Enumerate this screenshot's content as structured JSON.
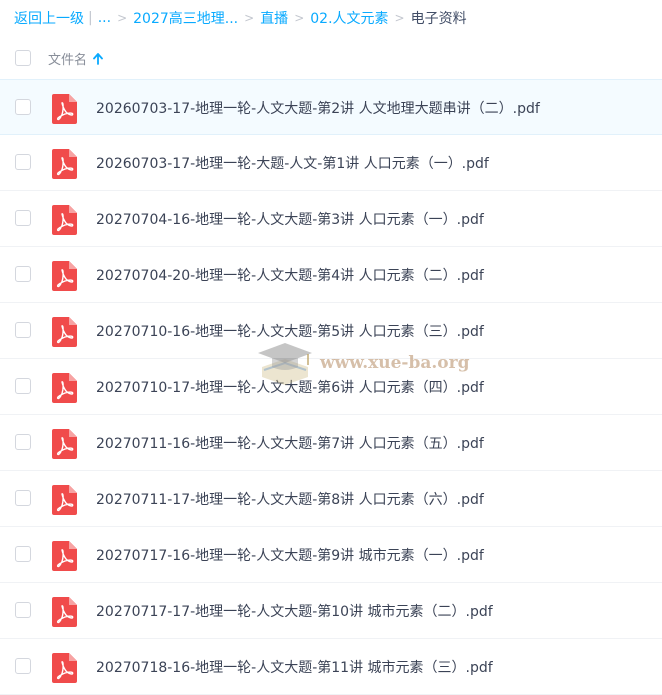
{
  "breadcrumb": {
    "back": "返回上一级",
    "ellipsis": "...",
    "crumbs": [
      "2027高三地理...",
      "直播",
      "02.人文元素"
    ],
    "current": "电子资料"
  },
  "header": {
    "column_label": "文件名"
  },
  "files": [
    "20260703-17-地理一轮-人文大题-第2讲 人文地理大题串讲（二）.pdf",
    "20260703-17-地理一轮-大题-人文-第1讲 人口元素（一）.pdf",
    "20270704-16-地理一轮-人文大题-第3讲 人口元素（一）.pdf",
    "20270704-20-地理一轮-人文大题-第4讲 人口元素（二）.pdf",
    "20270710-16-地理一轮-人文大题-第5讲 人口元素（三）.pdf",
    "20270710-17-地理一轮-人文大题-第6讲 人口元素（四）.pdf",
    "20270711-16-地理一轮-人文大题-第7讲 人口元素（五）.pdf",
    "20270711-17-地理一轮-人文大题-第8讲 人口元素（六）.pdf",
    "20270717-16-地理一轮-人文大题-第9讲 城市元素（一）.pdf",
    "20270717-17-地理一轮-人文大题-第10讲 城市元素（二）.pdf",
    "20270718-16-地理一轮-人文大题-第11讲 城市元素（三）.pdf"
  ],
  "watermark": {
    "text": "www.xue-ba.org"
  },
  "colors": {
    "link": "#09aaff",
    "pdf_red": "#f04b4b",
    "hover_row": "#f4fbff"
  },
  "icons": {
    "file": "pdf-icon",
    "sort": "arrow-up-icon"
  }
}
